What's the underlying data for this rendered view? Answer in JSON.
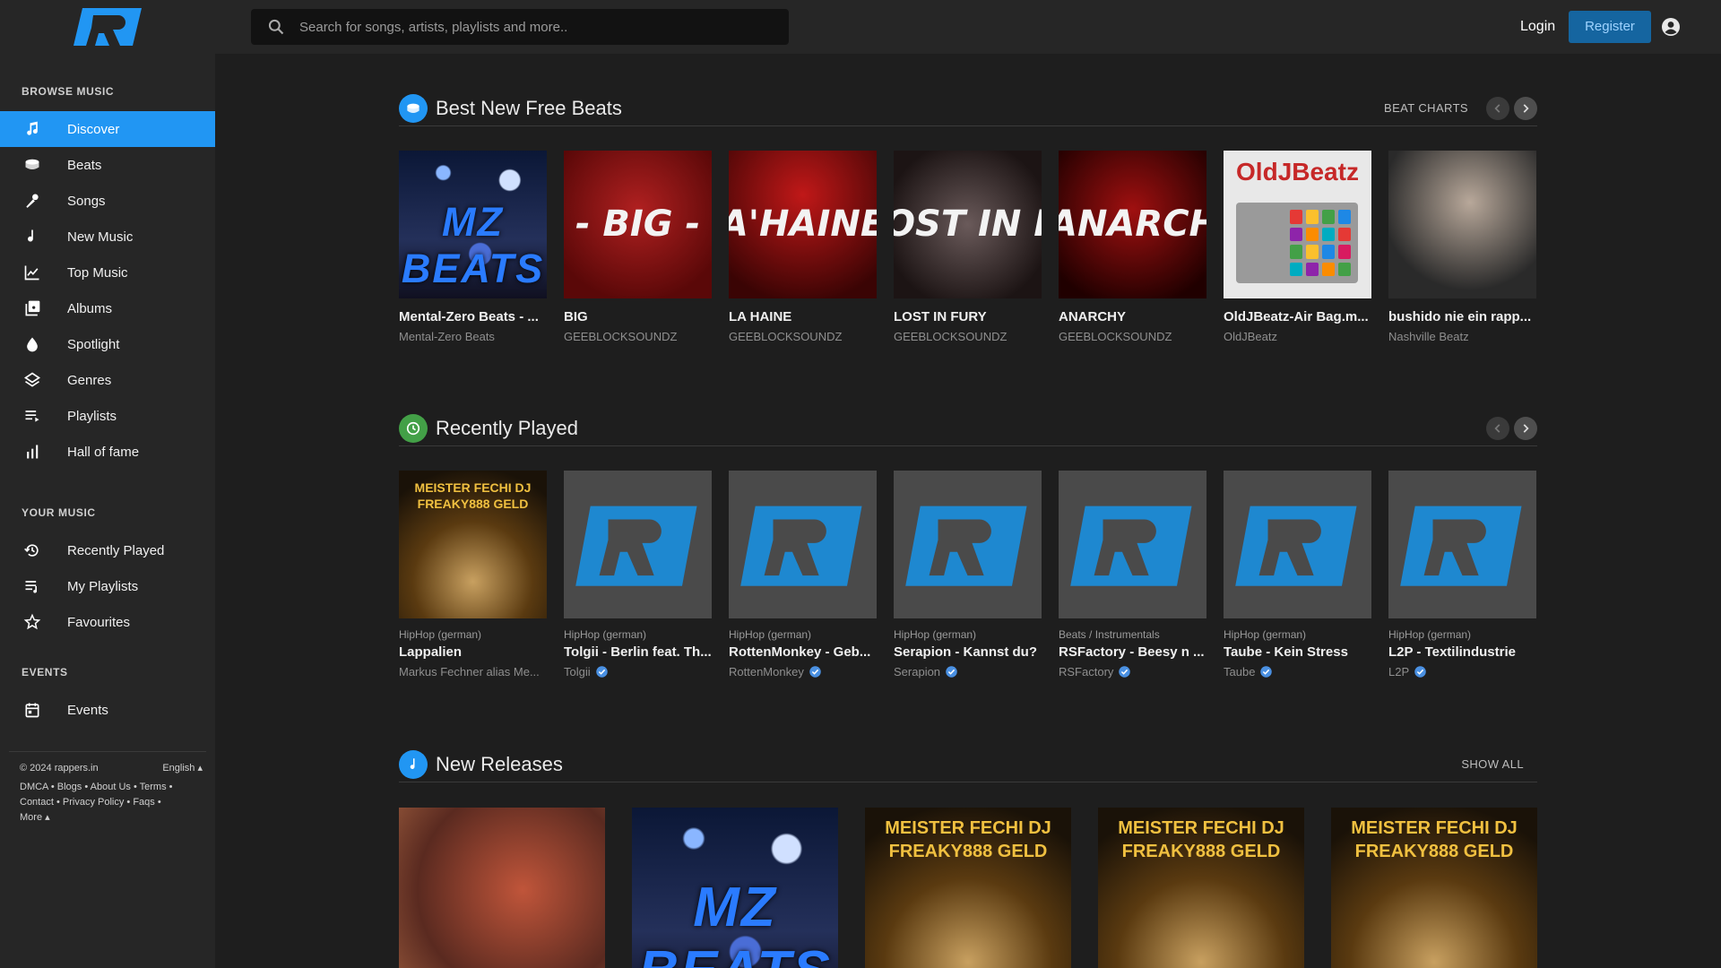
{
  "sidebar": {
    "browse_title": "BROWSE MUSIC",
    "browse_items": [
      {
        "label": "Discover",
        "icon": "music-note-icon"
      },
      {
        "label": "Beats",
        "icon": "drum-icon"
      },
      {
        "label": "Songs",
        "icon": "microphone-icon"
      },
      {
        "label": "New Music",
        "icon": "single-note-icon"
      },
      {
        "label": "Top Music",
        "icon": "line-chart-icon"
      },
      {
        "label": "Albums",
        "icon": "album-icon"
      },
      {
        "label": "Spotlight",
        "icon": "drop-icon"
      },
      {
        "label": "Genres",
        "icon": "layers-icon"
      },
      {
        "label": "Playlists",
        "icon": "playlist-icon"
      },
      {
        "label": "Hall of fame",
        "icon": "bar-chart-icon"
      }
    ],
    "your_title": "YOUR MUSIC",
    "your_items": [
      {
        "label": "Recently Played",
        "icon": "history-icon"
      },
      {
        "label": "My Playlists",
        "icon": "playlist-add-icon"
      },
      {
        "label": "Favourites",
        "icon": "star-icon"
      }
    ],
    "events_title": "EVENTS",
    "events_items": [
      {
        "label": "Events",
        "icon": "calendar-icon"
      }
    ],
    "footer": {
      "copyright": "© 2024 rappers.in",
      "language": "English ▴",
      "dmca": "DMCA",
      "blogs": "Blogs",
      "about": "About Us",
      "terms": "Terms",
      "contact": "Contact",
      "privacy": "Privacy Policy",
      "faqs": "Faqs",
      "more": "More ▴",
      "sep": " • "
    }
  },
  "topbar": {
    "search_placeholder": "Search for songs, artists, playlists and more..",
    "login": "Login",
    "register": "Register"
  },
  "colors": {
    "accent": "#2196f3",
    "recent": "#43a047"
  },
  "beats": {
    "title": "Best New Free Beats",
    "link": "BEAT CHARTS",
    "items": [
      {
        "title": "Mental-Zero Beats - ...",
        "artist": "Mental-Zero Beats",
        "cover_text": "MZ BEATS"
      },
      {
        "title": "BIG",
        "artist": "GEEBLOCKSOUNDZ",
        "cover_text": "- BIG -"
      },
      {
        "title": "LA HAINE",
        "artist": "GEEBLOCKSOUNDZ",
        "cover_text": "A'HAINE"
      },
      {
        "title": "LOST IN FURY",
        "artist": "GEEBLOCKSOUNDZ",
        "cover_text": "OST IN FUR"
      },
      {
        "title": "ANARCHY",
        "artist": "GEEBLOCKSOUNDZ",
        "cover_text": "ANARCHY"
      },
      {
        "title": "OldJBeatz-Air Bag.m...",
        "artist": "OldJBeatz",
        "cover_text": "OldJBeatz"
      },
      {
        "title": "bushido nie ein rapp...",
        "artist": "Nashville Beatz",
        "cover_text": ""
      }
    ]
  },
  "recent": {
    "title": "Recently Played",
    "items": [
      {
        "genre": "HipHop (german)",
        "title": "Lappalien",
        "artist": "Markus Fechner alias Me...",
        "cover_text": "MEISTER FECHI DJ FREAKY888 GELD"
      },
      {
        "genre": "HipHop (german)",
        "title": "Tolgii - Berlin feat. Th...",
        "artist": "Tolgii"
      },
      {
        "genre": "HipHop (german)",
        "title": "RottenMonkey - Geb...",
        "artist": "RottenMonkey"
      },
      {
        "genre": "HipHop (german)",
        "title": "Serapion - Kannst du?",
        "artist": "Serapion"
      },
      {
        "genre": "Beats / Instrumentals",
        "title": "RSFactory - Beesy n ...",
        "artist": "RSFactory"
      },
      {
        "genre": "HipHop (german)",
        "title": "Taube - Kein Stress",
        "artist": "Taube"
      },
      {
        "genre": "HipHop (german)",
        "title": "L2P - Textilindustrie",
        "artist": "L2P"
      }
    ]
  },
  "releases": {
    "title": "New Releases",
    "link": "SHOW ALL",
    "items": [
      {
        "cover_text": ""
      },
      {
        "cover_text": "MZ BEATS"
      },
      {
        "cover_text": "MEISTER FECHI DJ FREAKY888 GELD"
      },
      {
        "cover_text": "MEISTER FECHI DJ FREAKY888 GELD"
      },
      {
        "cover_text": "MEISTER FECHI DJ FREAKY888 GELD"
      }
    ]
  }
}
